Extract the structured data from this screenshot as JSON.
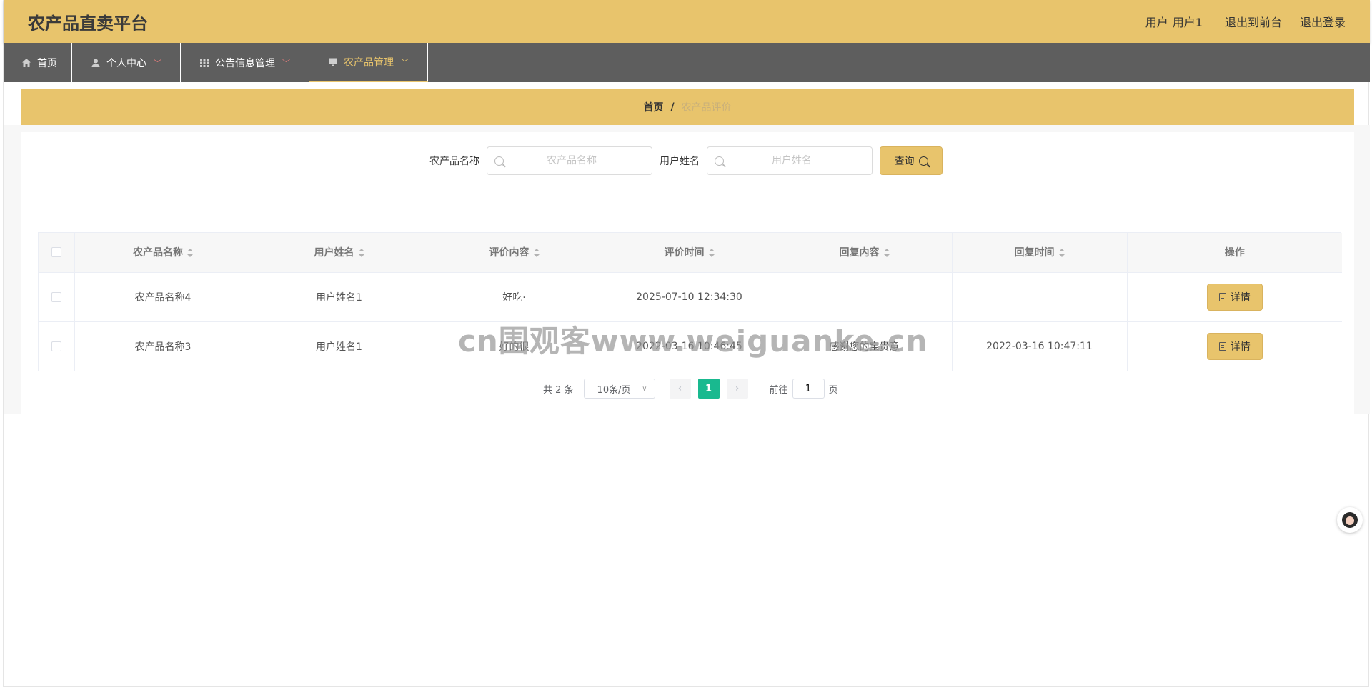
{
  "header": {
    "title": "农产品直卖平台",
    "user_label": "用户",
    "user_name": "用户1",
    "to_front": "退出到前台",
    "logout": "退出登录"
  },
  "nav": {
    "items": [
      {
        "label": "首页",
        "icon": "home-icon"
      },
      {
        "label": "个人中心",
        "icon": "user-icon"
      },
      {
        "label": "公告信息管理",
        "icon": "grid-icon"
      },
      {
        "label": "农产品管理",
        "icon": "monitor-icon"
      }
    ]
  },
  "breadcrumb": {
    "home": "首页",
    "separator": "/",
    "current": "农产品评价"
  },
  "search": {
    "product_label": "农产品名称",
    "product_placeholder": "农产品名称",
    "user_label": "用户姓名",
    "user_placeholder": "用户姓名",
    "query_label": "查询"
  },
  "table": {
    "columns": [
      "农产品名称",
      "用户姓名",
      "评价内容",
      "评价时间",
      "回复内容",
      "回复时间",
      "操作"
    ],
    "rows": [
      {
        "product": "农产品名称4",
        "user": "用户姓名1",
        "content": "好吃·",
        "time": "2025-07-10 12:34:30",
        "reply": "",
        "reply_time": "",
        "action": "详情"
      },
      {
        "product": "农产品名称3",
        "user": "用户姓名1",
        "content": "好的很",
        "time": "2022-03-16 10:46:45",
        "reply": "感谢您的宝贵意",
        "reply_time": "2022-03-16 10:47:11",
        "action": "详情"
      }
    ]
  },
  "pagination": {
    "total": "共 2 条",
    "page_size": "10条/页",
    "current_page": "1",
    "goto_label": "前往",
    "goto_value": "1",
    "page_unit": "页"
  },
  "watermark": "cn围观客www.weiguanke.cn",
  "colors": {
    "accent": "#e8c46c",
    "nav_bg": "#5e5e5e",
    "page_active": "#19b98f"
  }
}
